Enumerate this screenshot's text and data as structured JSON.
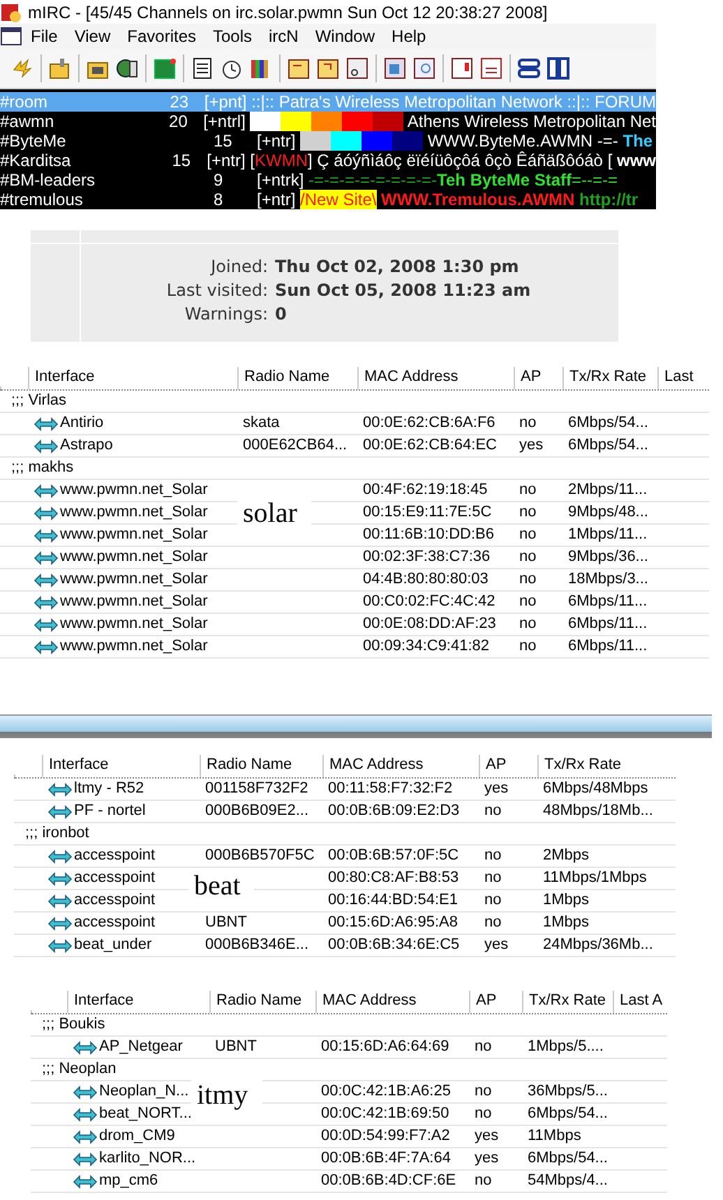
{
  "irc_window": {
    "title": "mIRC - [45/45 Channels on irc.solar.pwmn Sun Oct 12 20:38:27 2008]",
    "menu": [
      "File",
      "View",
      "Favorites",
      "Tools",
      "ircN",
      "Window",
      "Help"
    ],
    "channels": [
      {
        "name": "#room",
        "users": "23",
        "selected": true,
        "topic": [
          {
            "kind": "text",
            "text": "[+pnt] ::|:: Patra's Wireless Metropolitan Network ::|:: FORUM"
          }
        ]
      },
      {
        "name": "#awmn",
        "users": "20",
        "selected": false,
        "topic": [
          {
            "kind": "text",
            "text": "[+ntrl] "
          },
          {
            "kind": "swatch",
            "color": "#ffffff"
          },
          {
            "kind": "swatch",
            "color": "#ffff00"
          },
          {
            "kind": "swatch",
            "color": "#ff8000"
          },
          {
            "kind": "swatch",
            "color": "#ff0000"
          },
          {
            "kind": "swatch",
            "color": "#c00000"
          },
          {
            "kind": "text",
            "text": " Athens Wireless Metropolitan Net"
          }
        ]
      },
      {
        "name": "#ByteMe",
        "users": "15",
        "selected": false,
        "topic": [
          {
            "kind": "text",
            "text": "[+ntr] "
          },
          {
            "kind": "swatch",
            "color": "#d0d0d0"
          },
          {
            "kind": "swatch",
            "color": "#00ffff"
          },
          {
            "kind": "swatch",
            "color": "#0000ff"
          },
          {
            "kind": "swatch",
            "color": "#000080"
          },
          {
            "kind": "text",
            "text": "  WWW.ByteMe.AWMN -=- "
          },
          {
            "kind": "cyan",
            "text": "The",
            "bold": true
          }
        ]
      },
      {
        "name": "#Karditsa",
        "users": "15",
        "selected": false,
        "topic": [
          {
            "kind": "text",
            "text": "[+ntr]  ["
          },
          {
            "kind": "red",
            "text": "KWMN"
          },
          {
            "kind": "text",
            "text": "] Ç áóýñìáôç ëïéíüôçôá ôçò Êáñäßôóáò [ "
          },
          {
            "kind": "text",
            "text": "www",
            "bold": true
          }
        ]
      },
      {
        "name": "#BM-leaders",
        "users": "9",
        "selected": false,
        "topic": [
          {
            "kind": "text",
            "text": "[+ntrk] "
          },
          {
            "kind": "green",
            "text": "-=-=-=-=-=-=-=-=-"
          },
          {
            "kind": "lime",
            "text": "Teh ByteMe Staff",
            "bold": true
          },
          {
            "kind": "lime",
            "text": "=--=-="
          }
        ]
      },
      {
        "name": "#tremulous",
        "users": "8",
        "selected": false,
        "topic": [
          {
            "kind": "text",
            "text": "[+ntr] "
          },
          {
            "kind": "highlight",
            "text": "/New Site\\"
          },
          {
            "kind": "red",
            "text": " WWW.Tremulous.AWMN ",
            "bold": true
          },
          {
            "kind": "green",
            "text": " http://tr",
            "bold": true
          }
        ]
      }
    ]
  },
  "profile": {
    "fields": [
      {
        "label": "Joined:",
        "value": "Thu Oct 02, 2008 1:30 pm"
      },
      {
        "label": "Last visited:",
        "value": "Sun Oct 05, 2008 11:23 am"
      },
      {
        "label": "Warnings:",
        "value": "0"
      }
    ]
  },
  "tables": [
    {
      "columns": [
        "Interface",
        "Radio Name",
        "MAC Address",
        "AP",
        "Tx/Rx Rate",
        "Last"
      ],
      "overlay": "solar",
      "rows": [
        {
          "kind": "group",
          "name": ";;; Virlas"
        },
        {
          "kind": "entry",
          "interface": "Antirio",
          "radio": "skata",
          "mac": "00:0E:62:CB:6A:F6",
          "ap": "no",
          "rate": "6Mbps/54..."
        },
        {
          "kind": "entry",
          "interface": "Astrapo",
          "radio": "000E62CB64...",
          "mac": "00:0E:62:CB:64:EC",
          "ap": "yes",
          "rate": "6Mbps/54..."
        },
        {
          "kind": "group",
          "name": ";;; makhs"
        },
        {
          "kind": "entry",
          "interface": "www.pwmn.net_Solar",
          "mac": "00:4F:62:19:18:45",
          "ap": "no",
          "rate": "2Mbps/11..."
        },
        {
          "kind": "entry",
          "interface": "www.pwmn.net_Solar",
          "mac": "00:15:E9:11:7E:5C",
          "ap": "no",
          "rate": "9Mbps/48..."
        },
        {
          "kind": "entry",
          "interface": "www.pwmn.net_Solar",
          "mac": "00:11:6B:10:DD:B6",
          "ap": "no",
          "rate": "1Mbps/11..."
        },
        {
          "kind": "entry",
          "interface": "www.pwmn.net_Solar",
          "mac": "00:02:3F:38:C7:36",
          "ap": "no",
          "rate": "9Mbps/36..."
        },
        {
          "kind": "entry",
          "interface": "www.pwmn.net_Solar",
          "mac": "04:4B:80:80:80:03",
          "ap": "no",
          "rate": "18Mbps/3..."
        },
        {
          "kind": "entry",
          "interface": "www.pwmn.net_Solar",
          "mac": "00:C0:02:FC:4C:42",
          "ap": "no",
          "rate": "6Mbps/11..."
        },
        {
          "kind": "entry",
          "interface": "www.pwmn.net_Solar",
          "mac": "00:0E:08:DD:AF:23",
          "ap": "no",
          "rate": "6Mbps/11..."
        },
        {
          "kind": "entry",
          "interface": "www.pwmn.net_Solar",
          "mac": "00:09:34:C9:41:82",
          "ap": "no",
          "rate": "6Mbps/11..."
        }
      ]
    },
    {
      "columns": [
        "Interface",
        "Radio Name",
        "MAC Address",
        "AP",
        "Tx/Rx Rate"
      ],
      "overlay": "beat",
      "rows": [
        {
          "kind": "entry",
          "interface": "ltmy - R52",
          "radio": "001158F732F2",
          "mac": "00:11:58:F7:32:F2",
          "ap": "yes",
          "rate": "6Mbps/48Mbps"
        },
        {
          "kind": "entry",
          "interface": "PF - nortel",
          "radio": "000B6B09E2...",
          "mac": "00:0B:6B:09:E2:D3",
          "ap": "no",
          "rate": "48Mbps/18Mb..."
        },
        {
          "kind": "group",
          "name": ";;; ironbot"
        },
        {
          "kind": "entry",
          "interface": "accesspoint",
          "radio": "000B6B570F5C",
          "mac": "00:0B:6B:57:0F:5C",
          "ap": "no",
          "rate": "2Mbps"
        },
        {
          "kind": "entry",
          "interface": "accesspoint",
          "mac": "00:80:C8:AF:B8:53",
          "ap": "no",
          "rate": "11Mbps/1Mbps"
        },
        {
          "kind": "entry",
          "interface": "accesspoint",
          "mac": "00:16:44:BD:54:E1",
          "ap": "no",
          "rate": "1Mbps"
        },
        {
          "kind": "entry",
          "interface": "accesspoint",
          "radio": "UBNT",
          "mac": "00:15:6D:A6:95:A8",
          "ap": "no",
          "rate": "1Mbps"
        },
        {
          "kind": "entry",
          "interface": "beat_under",
          "radio": "000B6B346E...",
          "mac": "00:0B:6B:34:6E:C5",
          "ap": "yes",
          "rate": "24Mbps/36Mb..."
        }
      ]
    },
    {
      "columns": [
        "Interface",
        "Radio Name",
        "MAC Address",
        "AP",
        "Tx/Rx Rate",
        "Last A"
      ],
      "overlay": "itmy",
      "rows": [
        {
          "kind": "group",
          "name": ";;; Boukis"
        },
        {
          "kind": "entry",
          "interface": "AP_Netgear",
          "radio": "UBNT",
          "mac": "00:15:6D:A6:64:69",
          "ap": "no",
          "rate": "1Mbps/5...."
        },
        {
          "kind": "group",
          "name": ";;; Neoplan"
        },
        {
          "kind": "entry",
          "interface": "Neoplan_N...",
          "mac": "00:0C:42:1B:A6:25",
          "ap": "no",
          "rate": "36Mbps/5..."
        },
        {
          "kind": "entry",
          "interface": "beat_NORT...",
          "mac": "00:0C:42:1B:69:50",
          "ap": "no",
          "rate": "6Mbps/54..."
        },
        {
          "kind": "entry",
          "interface": "drom_CM9",
          "mac": "00:0D:54:99:F7:A2",
          "ap": "yes",
          "rate": "11Mbps"
        },
        {
          "kind": "entry",
          "interface": "karlito_NOR...",
          "mac": "00:0B:6B:4F:7A:64",
          "ap": "yes",
          "rate": "6Mbps/54..."
        },
        {
          "kind": "entry",
          "interface": "mp_cm6",
          "mac": "00:0B:6B:4D:CF:6E",
          "ap": "no",
          "rate": "54Mbps/4..."
        }
      ]
    }
  ]
}
